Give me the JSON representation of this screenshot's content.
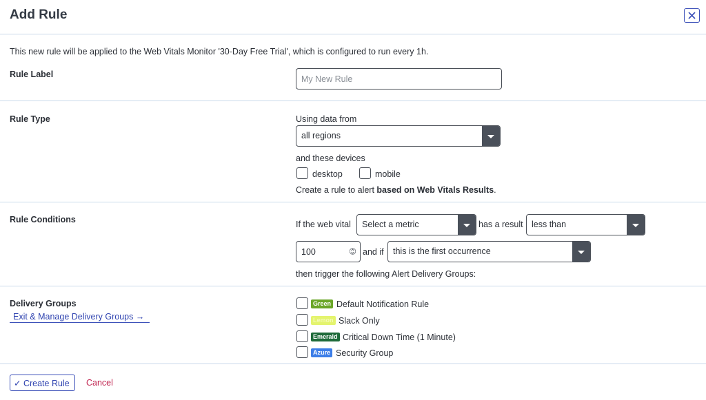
{
  "dialog": {
    "title": "Add Rule",
    "close_icon": "close-icon",
    "intro": "This new rule will be applied to the Web Vitals Monitor '30-Day Free Trial', which is configured to run every 1h."
  },
  "rule_label": {
    "label": "Rule Label",
    "placeholder": "My New Rule",
    "value": ""
  },
  "rule_type": {
    "label": "Rule Type",
    "using_data_from": "Using data from",
    "region_select": "all regions",
    "devices_label": "and these devices",
    "devices": [
      {
        "label": "desktop",
        "checked": false
      },
      {
        "label": "mobile",
        "checked": false
      }
    ],
    "note_prefix": "Create a rule to alert ",
    "note_bold": "based on Web Vitals Results",
    "note_suffix": "."
  },
  "rule_conditions": {
    "label": "Rule Conditions",
    "if_text": "If the web vital",
    "metric_select": "Select a metric",
    "has_result_text": "has a result",
    "comparison_select": "less than",
    "threshold_value": "100",
    "and_if_text": "and if",
    "occurrence_select": "this is the first occurrence",
    "then_text": "then trigger the following Alert Delivery Groups:"
  },
  "delivery_groups": {
    "label": "Delivery Groups",
    "manage_link": "Exit & Manage Delivery Groups →",
    "groups": [
      {
        "badge": "Green",
        "badge_color": "#6aa627",
        "badge_text_color": "#ffffff",
        "name": "Default Notification Rule",
        "checked": false
      },
      {
        "badge": "Lemon",
        "badge_color": "#e4f46e",
        "badge_text_color": "#f4fbb6",
        "name": "Slack Only",
        "checked": false
      },
      {
        "badge": "Emerald",
        "badge_color": "#1f6b3a",
        "badge_text_color": "#ffffff",
        "name": "Critical Down Time (1 Minute)",
        "checked": false
      },
      {
        "badge": "Azure",
        "badge_color": "#3d7ee8",
        "badge_text_color": "#ffffff",
        "name": "Security Group",
        "checked": false
      }
    ]
  },
  "footer": {
    "create_label": "✓ Create Rule",
    "cancel_label": "Cancel"
  },
  "colors": {
    "accent": "#2f43b0",
    "cancel": "#c0234f",
    "divider": "#c9d9ea",
    "select_arrow_bg": "#4a505a"
  }
}
